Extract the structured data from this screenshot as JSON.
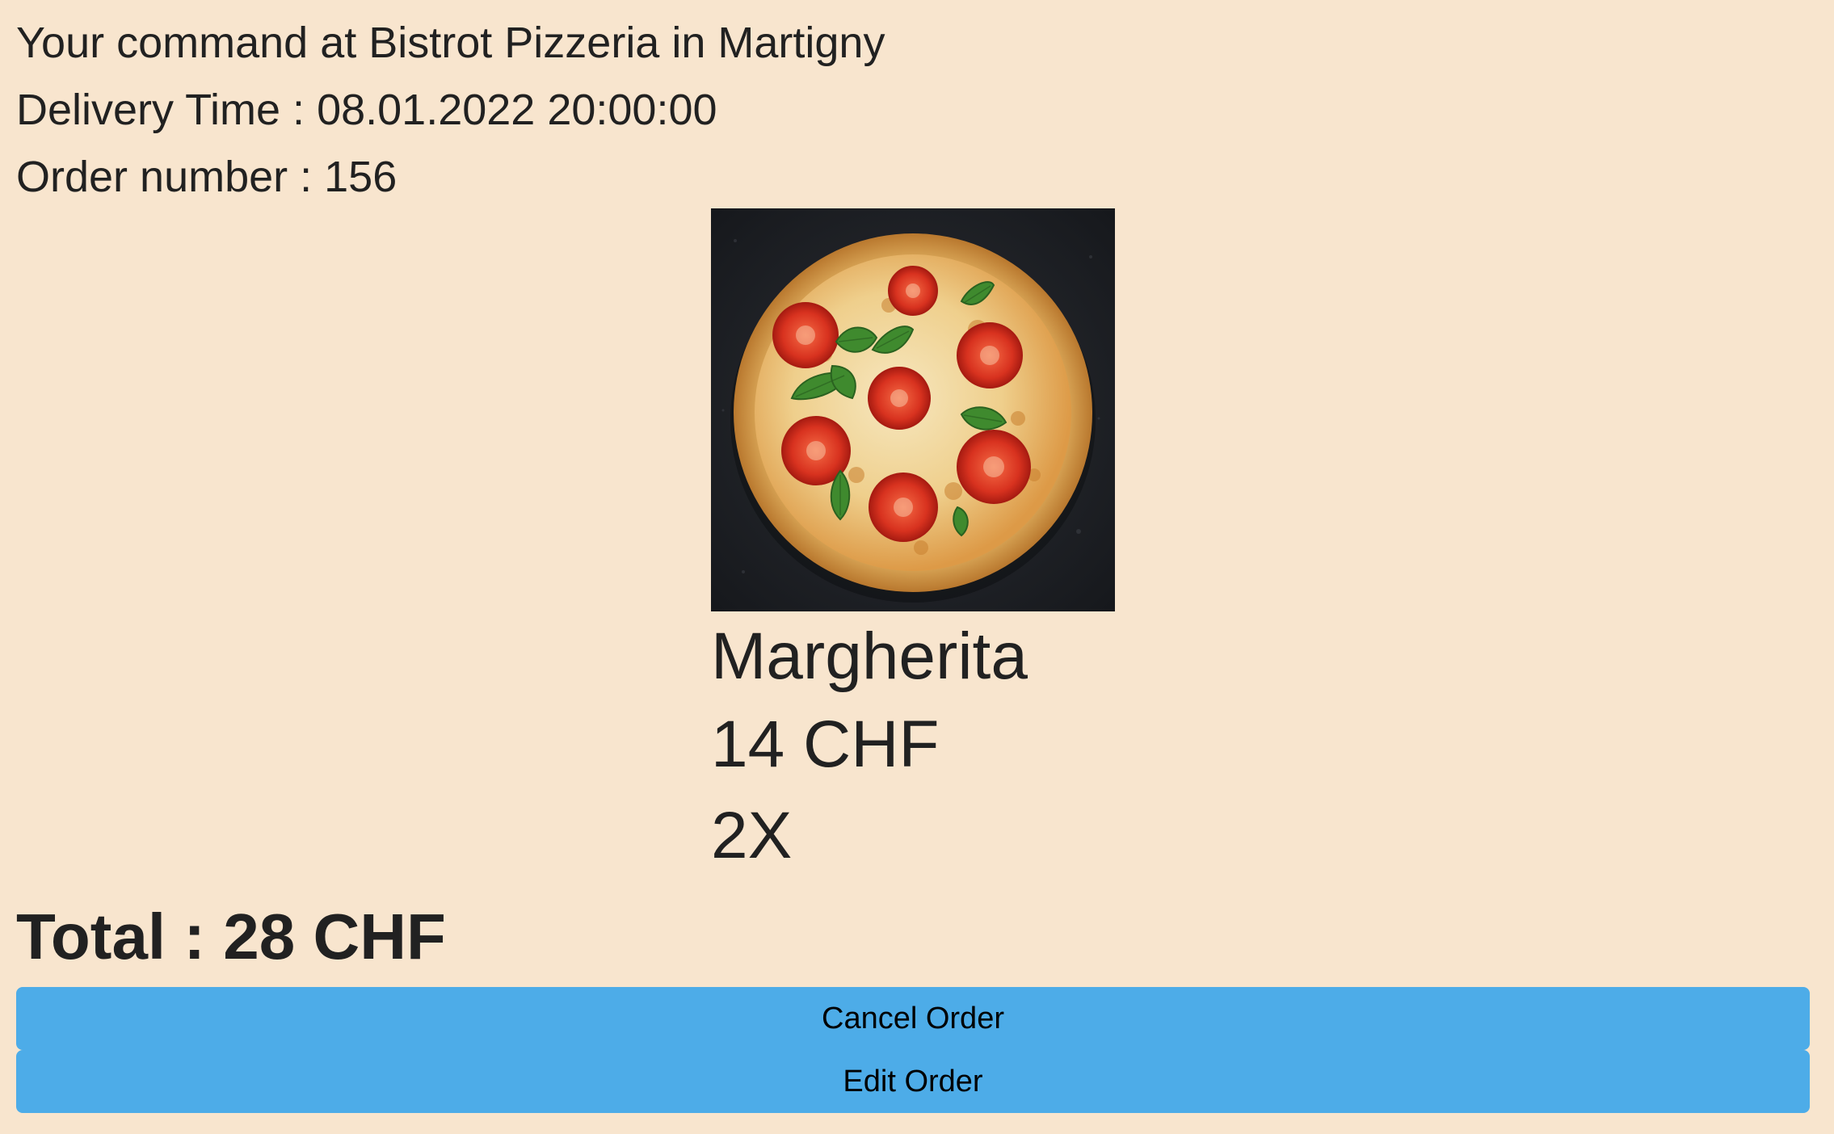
{
  "order": {
    "heading": "Your command at Bistrot Pizzeria in Martigny",
    "delivery_time": "Delivery Time : 08.01.2022 20:00:00",
    "order_number": "Order number : 156"
  },
  "item": {
    "name": "Margherita",
    "price": "14 CHF",
    "quantity": "2X"
  },
  "total": "Total : 28 CHF",
  "actions": {
    "cancel_label": "Cancel Order",
    "edit_label": "Edit Order"
  },
  "colors": {
    "background": "#f8e5ce",
    "button": "#4dace8"
  }
}
